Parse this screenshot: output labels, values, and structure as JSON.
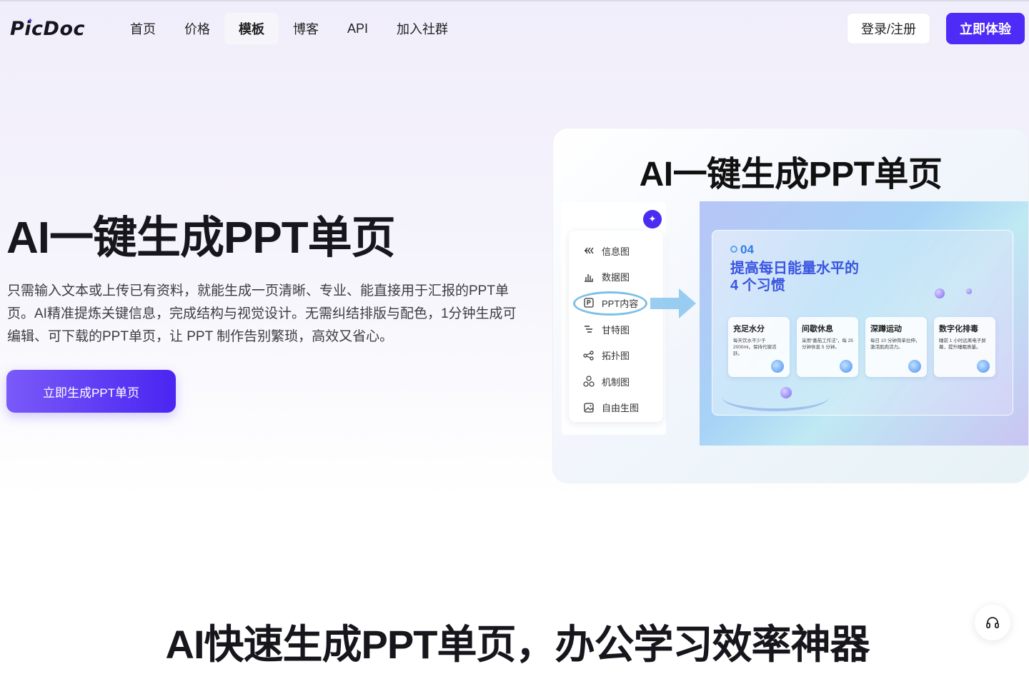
{
  "nav": {
    "logo": "PicDoc",
    "menu": [
      "首页",
      "价格",
      "模板",
      "博客",
      "API",
      "加入社群"
    ],
    "active": "模板",
    "login_label": "登录/注册",
    "cta_label": "立即体验"
  },
  "hero": {
    "title": "AI一键生成PPT单页",
    "description": "只需输入文本或上传已有资料，就能生成一页清晰、专业、能直接用于汇报的PPT单页。AI精准提炼关键信息，完成结构与视觉设计。无需纠结排版与配色，1分钟生成可编辑、可下载的PPT单页，让 PPT 制作告别繁琐，高效又省心。",
    "cta_label": "立即生成PPT单页"
  },
  "preview": {
    "title": "AI一键生成PPT单页",
    "menu": [
      {
        "label": "信息图",
        "icon": "infographic-icon"
      },
      {
        "label": "数据图",
        "icon": "bar-chart-icon"
      },
      {
        "label": "PPT内容",
        "icon": "ppt-icon"
      },
      {
        "label": "甘特图",
        "icon": "gantt-icon"
      },
      {
        "label": "拓扑图",
        "icon": "topology-icon"
      },
      {
        "label": "机制图",
        "icon": "mechanism-icon"
      },
      {
        "label": "自由生图",
        "icon": "image-icon"
      }
    ],
    "selected": "PPT内容",
    "slide": {
      "number": "04",
      "heading_line1": "提高每日能量水平的",
      "heading_line2": "4 个习惯",
      "cards": [
        {
          "title": "充足水分",
          "desc": "每天饮水不少于2000ml，保持代谢活跃。"
        },
        {
          "title": "间歇休息",
          "desc": "采用“番茄工作法”，每 25 分钟休息 5 分钟。"
        },
        {
          "title": "深蹲运动",
          "desc": "每日 10 分钟简单拉伸，激活肌肉活力。"
        },
        {
          "title": "数字化排毒",
          "desc": "睡前 1 小时远离电子屏幕，提升睡眠质量。"
        }
      ]
    }
  },
  "section2": {
    "title": "AI快速生成PPT单页，办公学习效率神器"
  },
  "colors": {
    "accent": "#4e2bf6",
    "cta_gradient_start": "#7a5af8",
    "cta_gradient_end": "#4a25f2"
  }
}
